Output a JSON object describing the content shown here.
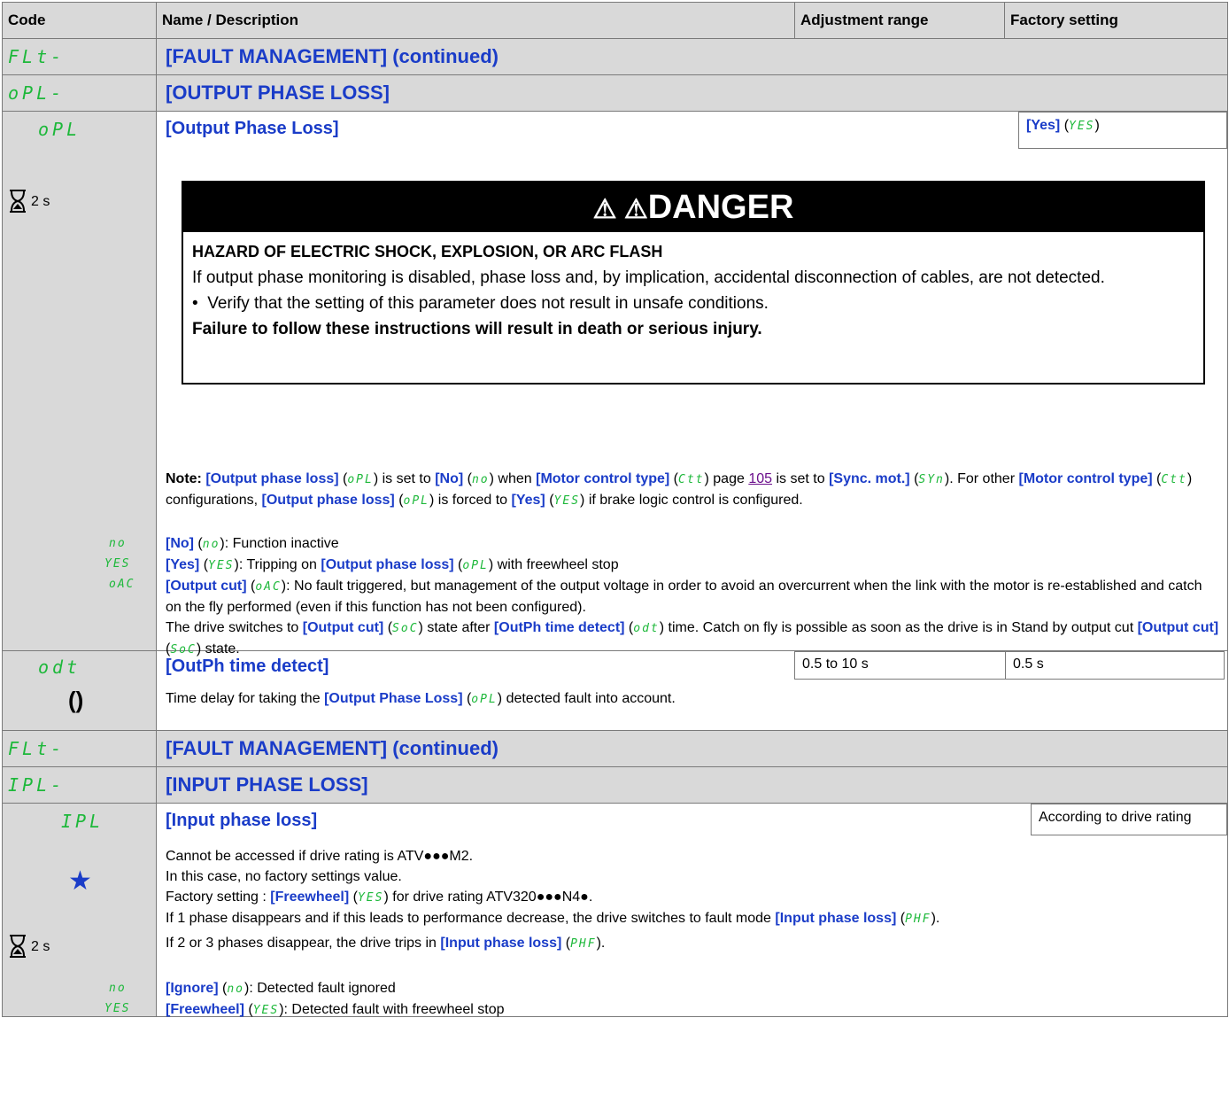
{
  "header": {
    "code": "Code",
    "name": "Name / Description",
    "range": "Adjustment range",
    "factory": "Factory setting"
  },
  "sections": [
    {
      "code": "FLt-",
      "title": "[FAULT MANAGEMENT] (continued)"
    },
    {
      "code": "oPL-",
      "title": "[OUTPUT PHASE LOSS]"
    },
    {
      "code": "FLt-",
      "title": "[FAULT MANAGEMENT] (continued)"
    },
    {
      "code": "IPL-",
      "title": "[INPUT PHASE LOSS]"
    }
  ],
  "opl": {
    "code": "oPL",
    "name": "[Output Phase Loss]",
    "factory_bracket": "[Yes]",
    "factory_code": "YES",
    "timer": "2 s",
    "danger": {
      "title": "DANGER",
      "hazard": "HAZARD OF ELECTRIC SHOCK, EXPLOSION, OR ARC FLASH",
      "text": "If output phase monitoring is disabled, phase loss and, by implication, accidental disconnection of cables, are not detected.",
      "bullet": "Verify that the setting of this parameter does not result in unsafe conditions.",
      "warning": "Failure to follow these instructions will result in death or serious injury."
    },
    "note": {
      "label": "Note:",
      "p1": "[Output phase loss]",
      "c1": "oPL",
      "t1": "is set to",
      "p2": "[No]",
      "c2": "no",
      "t2": "when",
      "p3": "[Motor control type]",
      "c3": "Ctt",
      "t3": "page",
      "page": "105",
      "t4": "is set to",
      "p4": "[Sync. mot.]",
      "c4": "SYn",
      "t5": ". For other",
      "p5": "[Motor control type]",
      "c5": "Ctt",
      "t6": "configurations,",
      "p6": "[Output phase loss]",
      "c6": "oPL",
      "t7": "is forced to",
      "p7": "[Yes]",
      "c7": "YES",
      "t8": "if brake logic control is configured."
    },
    "options": [
      {
        "code": "no",
        "label": "[No]",
        "lcd": "no",
        "desc": ": Function inactive"
      },
      {
        "code": "YES",
        "label": "[Yes]",
        "lcd": "YES",
        "desc": ": Tripping on",
        "extra_label": "[Output phase loss]",
        "extra_lcd": "oPL",
        "extra_desc": "with freewheel stop"
      },
      {
        "code": "oAC",
        "label": "[Output cut]",
        "lcd": "oAC",
        "desc": ": No fault triggered, but management of the output voltage in order to avoid an overcurrent when the link with the motor is re-established and catch on the fly performed (even if this function has not been configured)."
      }
    ],
    "switch": {
      "t1": "The drive switches to",
      "p1": "[Output cut]",
      "c1": "SoC",
      "t2": "state after",
      "p2": "[OutPh time detect]",
      "c2": "odt",
      "t3": "time. Catch on fly is possible as soon as the drive is in Stand by output cut",
      "p3": "[Output cut]",
      "c3": "SoC",
      "t4": "state."
    }
  },
  "odt": {
    "code": "odt",
    "name": "[OutPh time detect]",
    "range": "0.5 to 10 s",
    "factory": "0.5 s",
    "desc1": "Time delay for taking the",
    "desc_param": "[Output Phase Loss]",
    "desc_lcd": "oPL",
    "desc2": "detected fault into account."
  },
  "ipl": {
    "code": "IPL",
    "name": "[Input phase loss]",
    "factory": "According to drive rating",
    "timer": "2 s",
    "line1": "Cannot be accessed if drive rating is ATV●●●M2.",
    "line2": "In this case, no factory settings value.",
    "line3a": "Factory setting :",
    "line3p": "[Freewheel]",
    "line3c": "YES",
    "line3b": "for drive rating ATV320●●●N4●.",
    "line4a": "If 1 phase disappears and if this leads to performance decrease, the drive switches to fault mode",
    "line4p": "[Input phase loss]",
    "line4c": "PHF",
    "line5a": "If 2 or 3 phases disappear, the drive trips in",
    "line5p": "[Input phase loss]",
    "line5c": "PHF",
    "options": [
      {
        "code": "no",
        "label": "[Ignore]",
        "lcd": "no",
        "desc": ": Detected fault ignored"
      },
      {
        "code": "YES",
        "label": "[Freewheel]",
        "lcd": "YES",
        "desc": ": Detected fault with freewheel stop"
      }
    ]
  },
  "icons": {
    "timer": "hourglass-icon",
    "dynamic": "circular-arrows-icon",
    "expert": "star-icon",
    "warning": "warning-triangle-icon"
  },
  "colors": {
    "param_blue": "#1a3cc8",
    "lcd_green": "#1db83a",
    "header_gray": "#d9d9d9"
  }
}
